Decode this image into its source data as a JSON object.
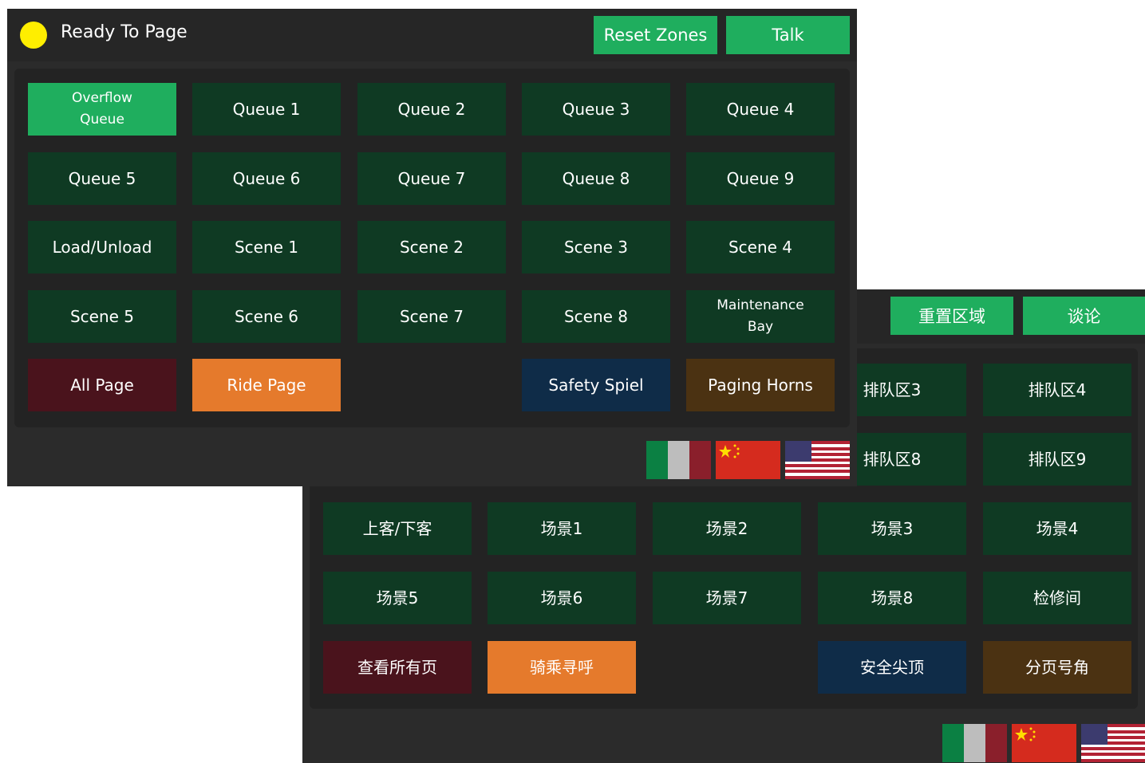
{
  "english": {
    "status_text": "Ready To Page",
    "header_buttons": [
      "Reset Zones",
      "Talk"
    ],
    "buttons": [
      [
        "Overflow Queue",
        "Queue 1",
        "Queue 2",
        "Queue 3",
        "Queue 4"
      ],
      [
        "Queue 5",
        "Queue 6",
        "Queue 7",
        "Queue 8",
        "Queue 9"
      ],
      [
        "Load/Unload",
        "Scene 1",
        "Scene 2",
        "Scene 3",
        "Scene 4"
      ],
      [
        "Scene 5",
        "Scene 6",
        "Scene 7",
        "Scene 8",
        "Maintenance Bay"
      ],
      [
        "All Page",
        "Ride Page",
        "",
        "Safety Spiel",
        "Paging Horns"
      ]
    ]
  },
  "chinese": {
    "header_buttons": [
      "重置区域",
      "谈论"
    ],
    "buttons": [
      [
        "",
        "",
        "",
        "排队区3",
        "排队区4"
      ],
      [
        "",
        "",
        "",
        "排队区8",
        "排队区9"
      ],
      [
        "上客/下客",
        "场景1",
        "场景2",
        "场景3",
        "场景4"
      ],
      [
        "场景5",
        "场景6",
        "场景7",
        "场景8",
        "检修间"
      ],
      [
        "查看所有页",
        "骑乘寻呼",
        "",
        "安全尖顶",
        "分页号角"
      ]
    ]
  },
  "flags": [
    "italy-flag",
    "china-flag",
    "usa-flag"
  ],
  "colors": {
    "zone_button": "#0f3a23",
    "active_button": "#1fae5e",
    "all_page": "#4a131c",
    "ride_page": "#e57a2c",
    "safety_spiel": "#0f2c48",
    "paging_horns": "#4b3212",
    "status_dot": "#ffee00"
  }
}
